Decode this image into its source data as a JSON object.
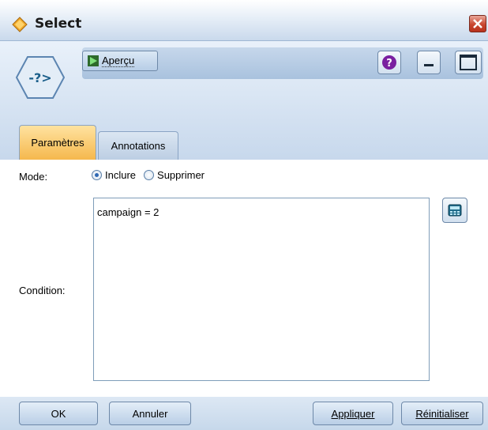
{
  "window": {
    "title": "Select",
    "close_icon": "close-icon"
  },
  "toolbar": {
    "preview_label": "Aperçu",
    "help_icon": "help-icon",
    "minimize_icon": "minimize-icon",
    "maximize_icon": "maximize-icon"
  },
  "node": {
    "icon_text": "-?>"
  },
  "tabs": [
    {
      "label": "Paramètres",
      "active": true
    },
    {
      "label": "Annotations",
      "active": false
    }
  ],
  "form": {
    "mode_label": "Mode:",
    "mode_options": [
      {
        "label": "Inclure",
        "checked": true
      },
      {
        "label": "Supprimer",
        "checked": false
      }
    ],
    "condition_label": "Condition:",
    "condition_value": "campaign = 2",
    "expression_builder_icon": "calculator-icon"
  },
  "buttons": {
    "ok": "OK",
    "cancel": "Annuler",
    "apply": "Appliquer",
    "reset": "Réinitialiser"
  },
  "colors": {
    "active_tab": "#f5b84d",
    "close_button": "#c9462f",
    "help_button": "#7a1fa0",
    "header_gradient": "#c7d8ec"
  }
}
